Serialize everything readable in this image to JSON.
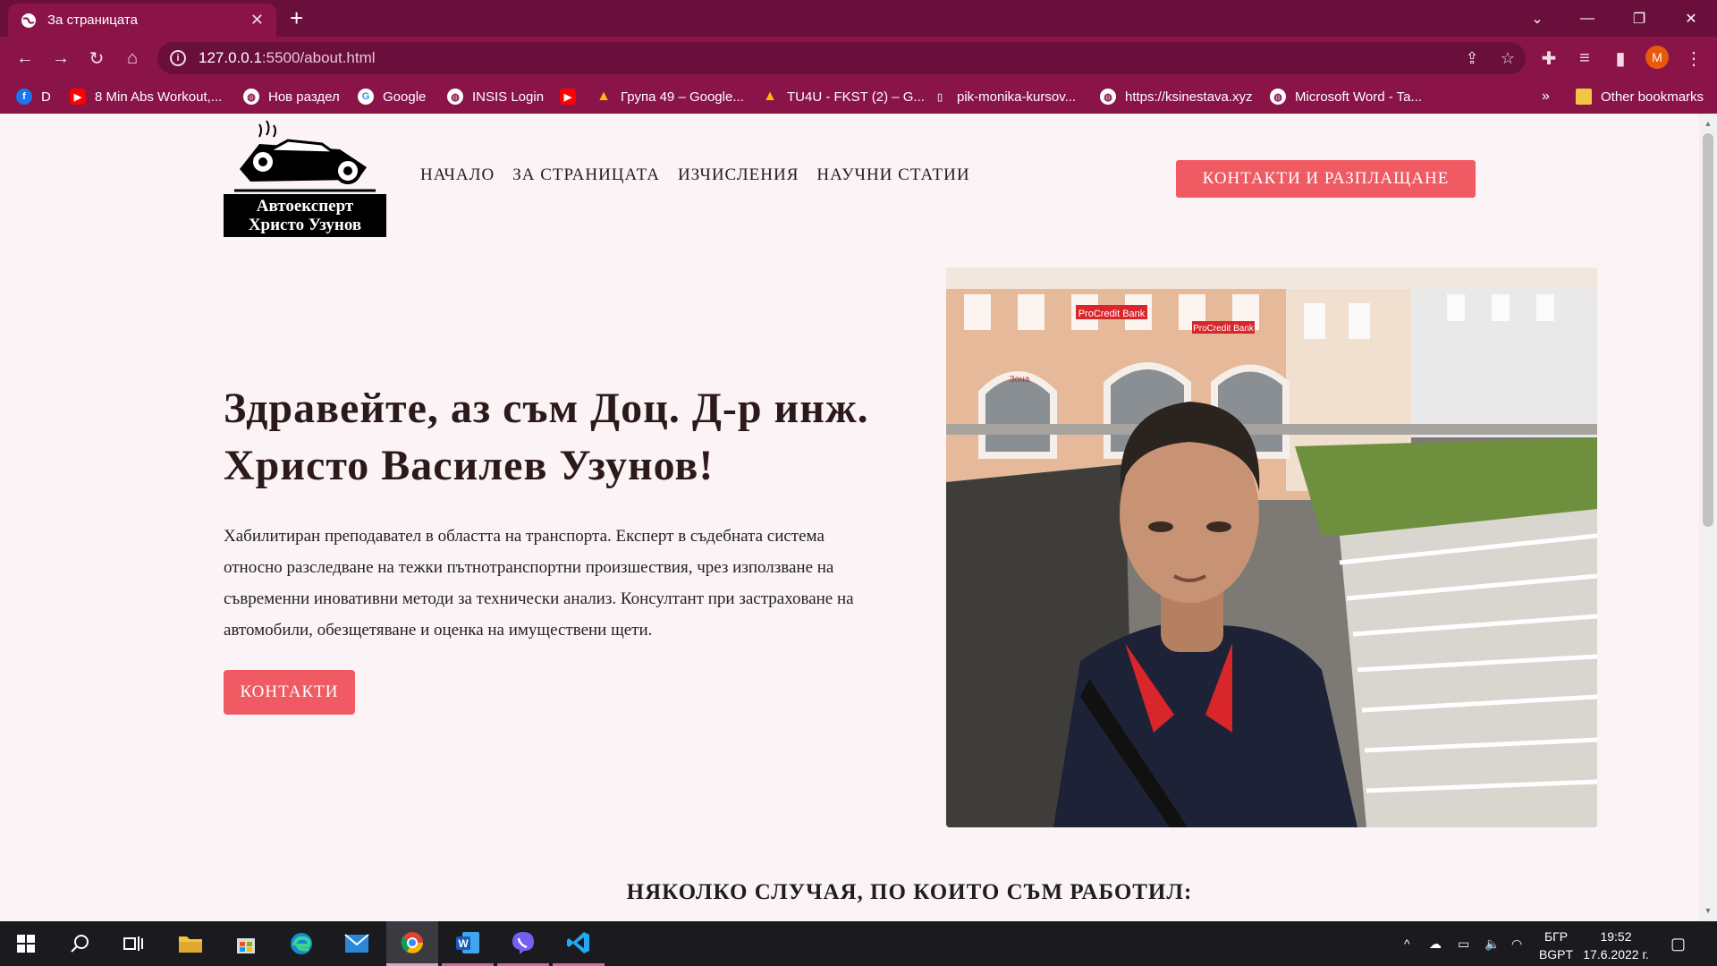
{
  "browser": {
    "tab_title": "За страницата",
    "url_host": "127.0.0.1",
    "url_path": ":5500/about.html",
    "profile_initial": "M",
    "bookmarks": [
      {
        "label": "D",
        "icon": "facebook-icon",
        "color": "#1877f2"
      },
      {
        "label": "8 Min Abs Workout,...",
        "icon": "youtube-icon",
        "color": "#ff0000"
      },
      {
        "label": "Нов раздел",
        "icon": "globe-icon",
        "color": "#ffffff"
      },
      {
        "label": "Google",
        "icon": "google-icon",
        "color": "#ffffff"
      },
      {
        "label": "INSIS Login",
        "icon": "globe-icon",
        "color": "#ffffff"
      },
      {
        "label": "",
        "icon": "youtube-icon",
        "color": "#ff0000"
      },
      {
        "label": "Група 49 – Google...",
        "icon": "google-drive-icon",
        "color": "#fbbc04"
      },
      {
        "label": "TU4U - FKST (2) – G...",
        "icon": "google-drive-icon",
        "color": "#fbbc04"
      },
      {
        "label": "pik-monika-kursov...",
        "icon": "file-icon",
        "color": "#cccccc"
      },
      {
        "label": "https://ksinestava.xyz",
        "icon": "globe-icon",
        "color": "#ffffff"
      },
      {
        "label": "Microsoft Word - Ta...",
        "icon": "globe-icon",
        "color": "#ffffff"
      }
    ],
    "more_bookmarks": "»",
    "other_bookmarks": "Other bookmarks"
  },
  "site": {
    "logo_line1": "Автоексперт",
    "logo_line2": "Христо Узунов",
    "nav": [
      "НАЧАЛО",
      "ЗА СТРАНИЦАТА",
      "ИЗЧИСЛЕНИЯ",
      "НАУЧНИ СТАТИИ"
    ],
    "cta_top": "КОНТАКТИ И РАЗПЛАЩАНЕ",
    "hero_title": "Здравейте, аз съм Доц. Д-р инж. Христо Василев Узунов!",
    "hero_text": "Хабилитиран преподавател в областта на транспорта. Експерт в съдебната система относно разследване на тежки пътнотранспортни произшествия, чрез използване на съвременни иновативни методи за технически анализ. Консултант при застраховане на автомобили, обезщетяване и оценка на имуществени щети.",
    "cta_contact": "КОНТАКТИ",
    "section_title": "НЯКОЛКО СЛУЧАЯ, ПО КОИТО СЪМ РАБОТИЛ:",
    "photo_signs": [
      "ProCredit Bank",
      "ProCredit Bank",
      "Зона"
    ]
  },
  "taskbar": {
    "language_top": "БГР",
    "language_bottom": "BGPT",
    "time": "19:52",
    "date": "17.6.2022 г."
  },
  "colors": {
    "brand_dark": "#6a0e3b",
    "brand": "#8a1448",
    "accent_button": "#f05a63",
    "page_bg": "#fbf3f5"
  }
}
